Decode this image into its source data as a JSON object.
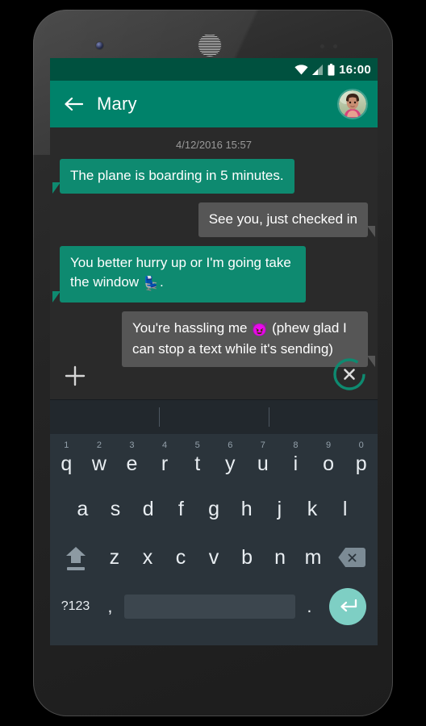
{
  "device": {
    "camera_icon": "front-camera",
    "speaker_icon": "earpiece-speaker",
    "sensor_icon": "proximity-sensor"
  },
  "statusbar": {
    "wifi_icon": "wifi-icon",
    "signal_icon": "cellular-signal-icon",
    "battery_icon": "battery-full-icon",
    "clock": "16:00"
  },
  "appbar": {
    "back_icon": "back-arrow-icon",
    "title": "Mary",
    "avatar_icon": "contact-avatar"
  },
  "chat": {
    "timestamp": "4/12/2016 15:57",
    "messages": [
      {
        "side": "out",
        "text": "The plane is boarding in 5 minutes."
      },
      {
        "side": "in",
        "text": "See you, just checked in"
      },
      {
        "side": "out",
        "text_before": "You better hurry up or I'm going take the window ",
        "emoji": "💺",
        "emoji_name": "seat-emoji",
        "text_after": "."
      },
      {
        "side": "in",
        "text_before": "You're hassling me ",
        "emoji": "😈",
        "emoji_name": "smiling-devil-emoji",
        "text_after": " (phew glad I can stop a text while it's sending)"
      }
    ],
    "attach_icon": "plus-attach-icon",
    "cancel_send_icon": "cancel-send-icon",
    "cancel_send_progress": 85
  },
  "suggestions": {
    "slot1": "",
    "slot2": "",
    "slot3": ""
  },
  "keyboard": {
    "row1": [
      {
        "letter": "q",
        "num": "1"
      },
      {
        "letter": "w",
        "num": "2"
      },
      {
        "letter": "e",
        "num": "3"
      },
      {
        "letter": "r",
        "num": "4"
      },
      {
        "letter": "t",
        "num": "5"
      },
      {
        "letter": "y",
        "num": "6"
      },
      {
        "letter": "u",
        "num": "7"
      },
      {
        "letter": "i",
        "num": "8"
      },
      {
        "letter": "o",
        "num": "9"
      },
      {
        "letter": "p",
        "num": "0"
      }
    ],
    "row2": [
      "a",
      "s",
      "d",
      "f",
      "g",
      "h",
      "j",
      "k",
      "l"
    ],
    "row3": [
      "z",
      "x",
      "c",
      "v",
      "b",
      "n",
      "m"
    ],
    "shift_icon": "shift-caps-icon",
    "backspace_icon": "backspace-icon",
    "symbols_label": "?123",
    "comma_label": ",",
    "period_label": ".",
    "space_label": "",
    "enter_icon": "enter-return-icon"
  },
  "colors": {
    "status_bar": "#00513f",
    "app_bar": "#00826a",
    "outgoing_bubble": "#0e8a70",
    "incoming_bubble": "#565656",
    "chat_background": "#2a2a2a",
    "keyboard_background": "#2b343b",
    "suggestion_background": "#22282d",
    "enter_key": "#7ecfc4",
    "cancel_ring": "#0e8a70"
  }
}
